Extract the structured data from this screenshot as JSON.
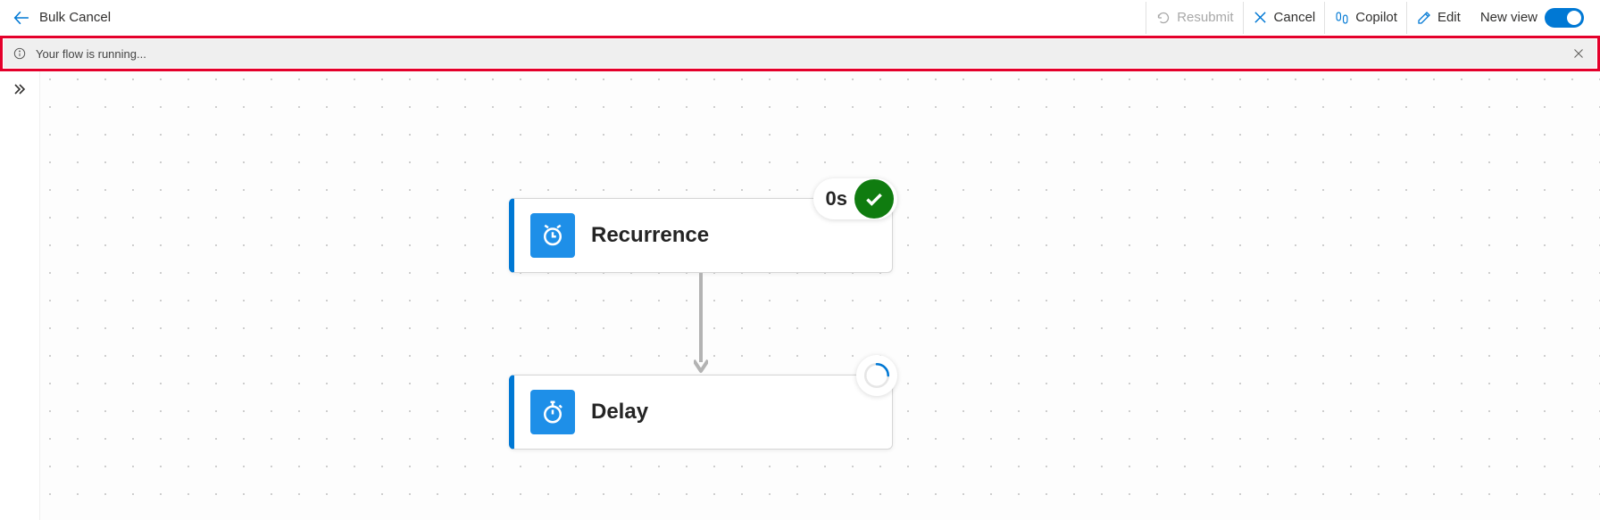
{
  "header": {
    "title": "Bulk Cancel",
    "buttons": {
      "resubmit": "Resubmit",
      "cancel": "Cancel",
      "copilot": "Copilot",
      "edit": "Edit",
      "newview": "New view"
    }
  },
  "notification": {
    "message": "Your flow is running..."
  },
  "cards": {
    "recurrence": {
      "label": "Recurrence",
      "duration": "0s"
    },
    "delay": {
      "label": "Delay"
    }
  }
}
